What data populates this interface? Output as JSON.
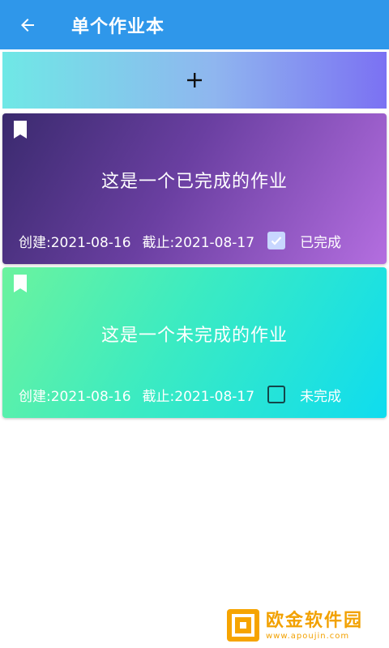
{
  "header": {
    "title": "单个作业本"
  },
  "add_bar": {
    "label": "+"
  },
  "cards": [
    {
      "title": "这是一个已完成的作业",
      "created": "创建:2021-08-16",
      "deadline": "截止:2021-08-17",
      "status": "已完成",
      "checked": true
    },
    {
      "title": "这是一个未完成的作业",
      "created": "创建:2021-08-16",
      "deadline": "截止:2021-08-17",
      "status": "未完成",
      "checked": false
    }
  ],
  "watermark": {
    "name": "欧金软件园",
    "url": "www.apoujin.com"
  },
  "colors": {
    "app_bar": "#2f97ea",
    "watermark": "#f2a100"
  },
  "icons": [
    "arrow-left-icon",
    "plus-icon",
    "bookmark-icon",
    "check-icon"
  ]
}
